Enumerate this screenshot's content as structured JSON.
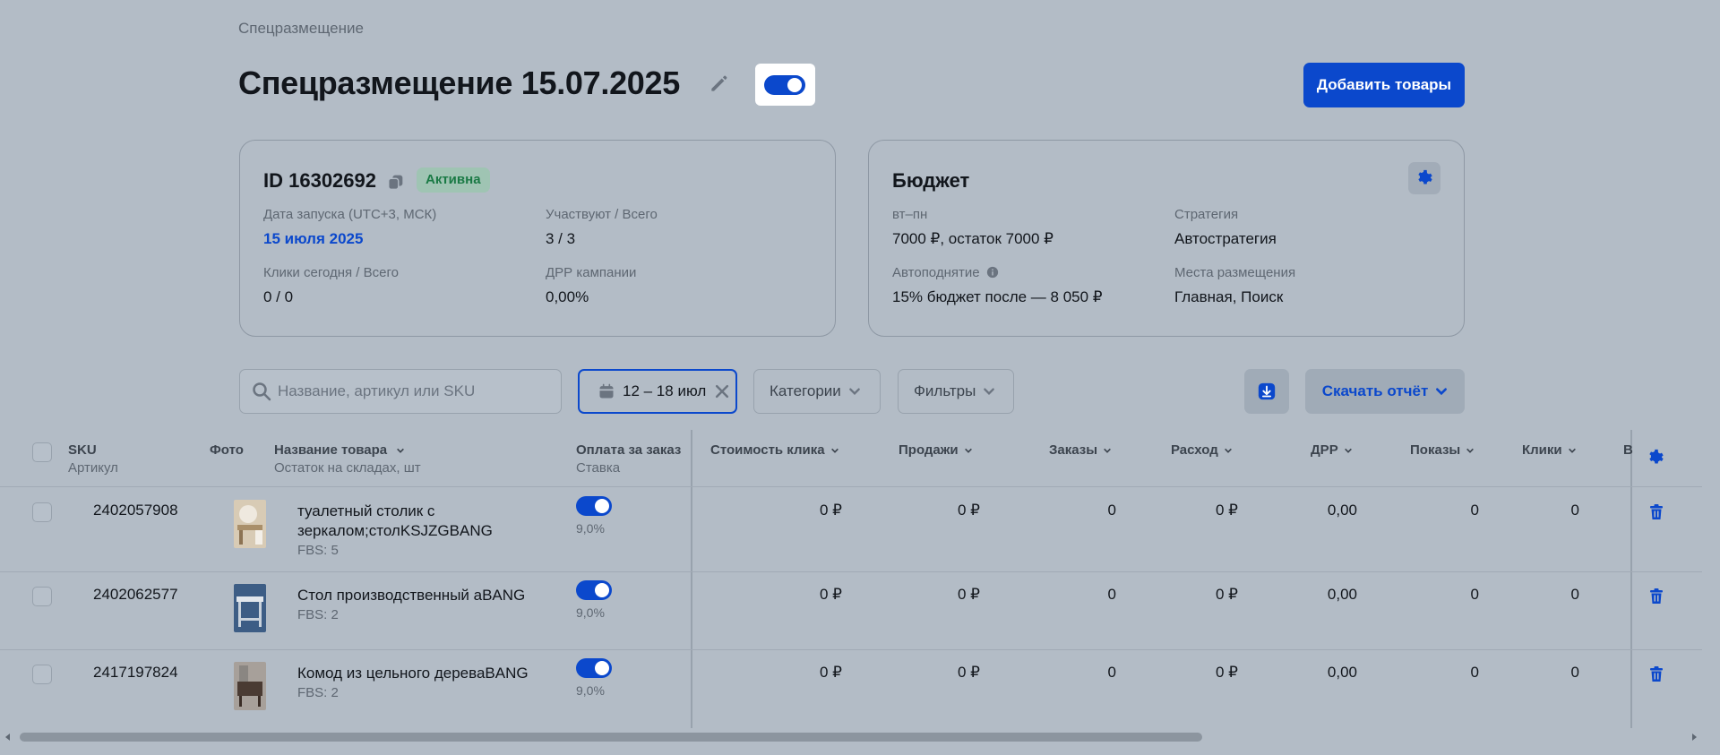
{
  "breadcrumb": "Спецразмещение",
  "title": "Спецразмещение 15.07.2025",
  "header": {
    "add_button": "Добавить товары",
    "campaign_toggle_on": true
  },
  "campaign_card": {
    "id_label": "ID 16302692",
    "status": "Активна",
    "launch_label": "Дата запуска (UTC+3, МСК)",
    "launch_value": "15 июля 2025",
    "participants_label": "Участвуют / Всего",
    "participants_value": "3 / 3",
    "clicks_label": "Клики сегодня / Всего",
    "clicks_value": "0 / 0",
    "drr_label": "ДРР кампании",
    "drr_value": "0,00%"
  },
  "budget_card": {
    "title": "Бюджет",
    "period_label": "вт–пн",
    "period_value": "7000 ₽, остаток 7000 ₽",
    "strategy_label": "Стратегия",
    "strategy_value": "Автостратегия",
    "autoraise_label": "Автоподнятие",
    "autoraise_value": "15% бюджет после — 8 050 ₽",
    "placement_label": "Места размещения",
    "placement_value": "Главная, Поиск"
  },
  "toolbar": {
    "search_placeholder": "Название, артикул или SKU",
    "date_range": "12 – 18 июл",
    "categories": "Категории",
    "filters": "Фильтры",
    "download_report": "Скачать отчёт"
  },
  "columns": {
    "sku": "SKU",
    "article": "Артикул",
    "photo": "Фото",
    "name": "Название товара",
    "stock": "Остаток на складах, шт",
    "pay_per_order": "Оплата за заказ",
    "rate": "Ставка",
    "click_cost": "Стоимость клика",
    "sales": "Продажи",
    "orders": "Заказы",
    "spend": "Расход",
    "drr": "ДРР",
    "views": "Показы",
    "clicks": "Клики",
    "cut": "В"
  },
  "rows": [
    {
      "sku": "2402057908",
      "name_line1": "туалетный столик с",
      "name_line2": "зеркалом;столKSJZGBANG",
      "stock": "FBS: 5",
      "toggle_on": true,
      "rate": "9,0%",
      "click_cost": "0 ₽",
      "sales": "0 ₽",
      "orders": "0",
      "spend": "0 ₽",
      "drr": "0,00",
      "views": "0",
      "clicks": "0"
    },
    {
      "sku": "2402062577",
      "name_line1": "Стол производственный aBANG",
      "name_line2": "",
      "stock": "FBS: 2",
      "toggle_on": true,
      "rate": "9,0%",
      "click_cost": "0 ₽",
      "sales": "0 ₽",
      "orders": "0",
      "spend": "0 ₽",
      "drr": "0,00",
      "views": "0",
      "clicks": "0"
    },
    {
      "sku": "2417197824",
      "name_line1": "Комод из цельного дереваBANG",
      "name_line2": "",
      "stock": "FBS: 2",
      "toggle_on": true,
      "rate": "9,0%",
      "click_cost": "0 ₽",
      "sales": "0 ₽",
      "orders": "0",
      "spend": "0 ₽",
      "drr": "0,00",
      "views": "0",
      "clicks": "0"
    }
  ],
  "colors": {
    "accent": "#0b48cc",
    "overlay_bg": "#b3bcc6",
    "status_green": "#1a7a45"
  }
}
